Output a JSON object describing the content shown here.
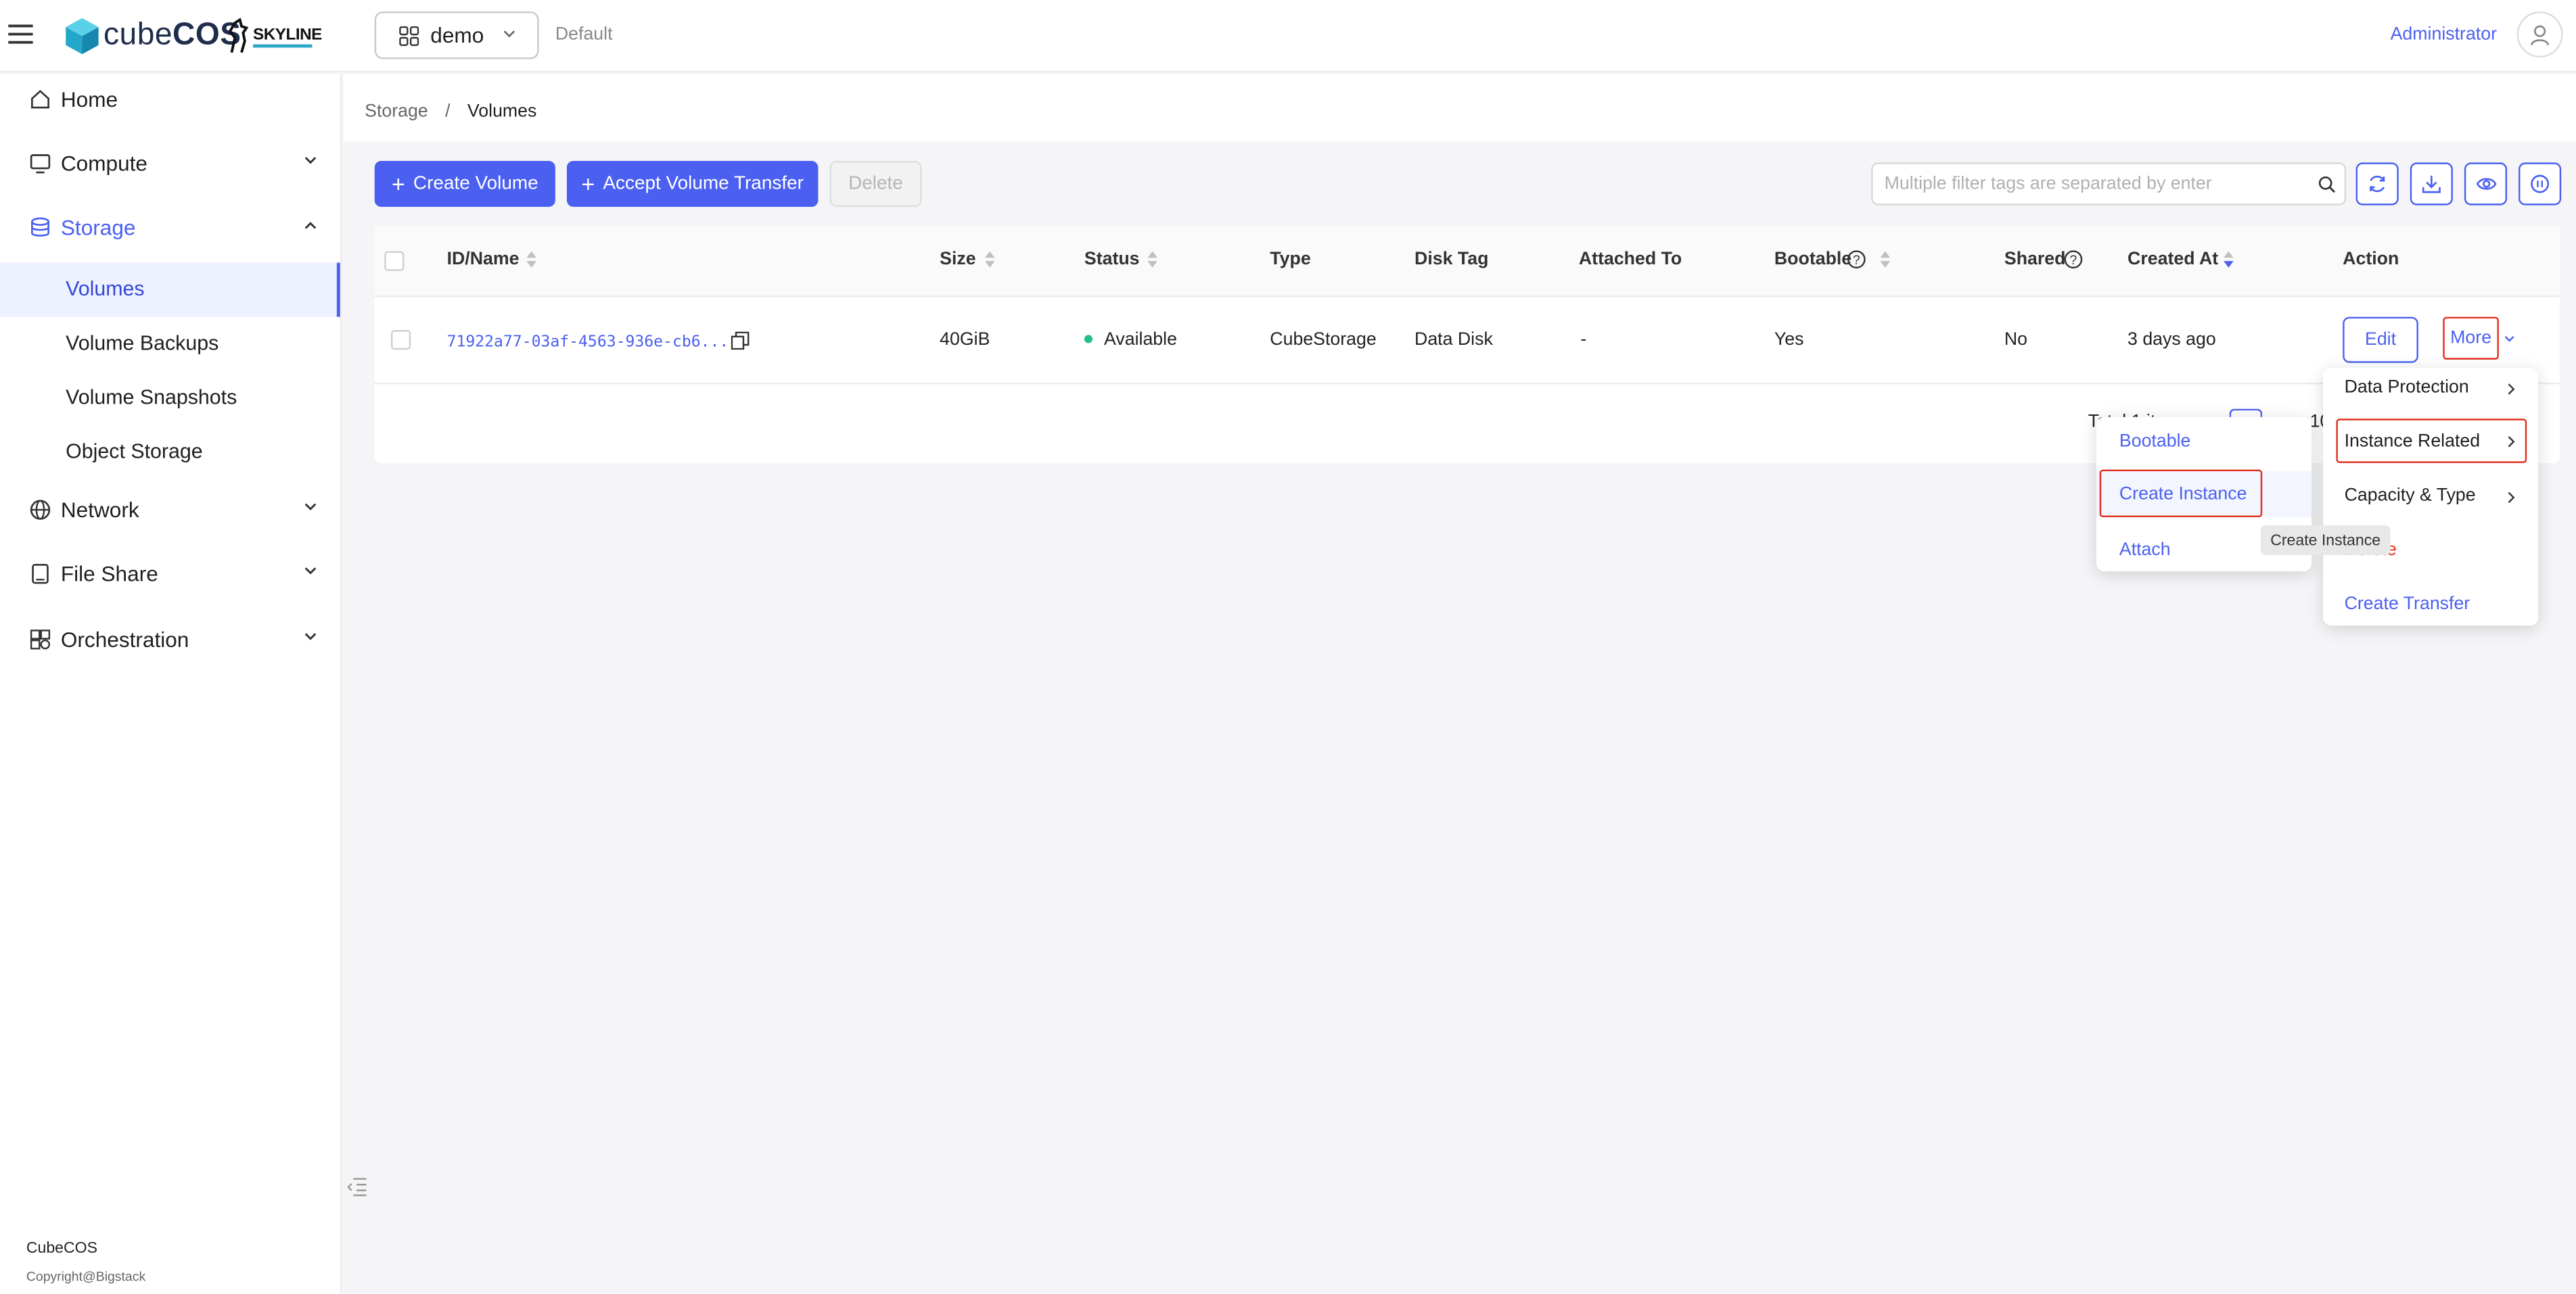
{
  "app": {
    "logo_text_light": "cube",
    "logo_text_bold": "COS",
    "skyline": "SKYLINE",
    "project": "demo",
    "domain": "Default",
    "user": "Administrator"
  },
  "sidebar": {
    "items": [
      {
        "label": "Home",
        "icon": "home-icon"
      },
      {
        "label": "Compute",
        "icon": "monitor-icon"
      },
      {
        "label": "Storage",
        "icon": "database-icon"
      },
      {
        "label": "Network",
        "icon": "globe-icon"
      },
      {
        "label": "File Share",
        "icon": "file-share-icon"
      },
      {
        "label": "Orchestration",
        "icon": "orchestration-icon"
      }
    ],
    "storage_sub": [
      "Volumes",
      "Volume Backups",
      "Volume Snapshots",
      "Object Storage"
    ],
    "footer_name": "CubeCOS",
    "footer_copy": "Copyright@Bigstack"
  },
  "breadcrumb": {
    "parent": "Storage",
    "sep": "/",
    "current": "Volumes"
  },
  "toolbar": {
    "create_volume": "Create Volume",
    "accept_transfer": "Accept Volume Transfer",
    "delete": "Delete",
    "search_placeholder": "Multiple filter tags are separated by enter"
  },
  "table": {
    "columns": [
      "ID/Name",
      "Size",
      "Status",
      "Type",
      "Disk Tag",
      "Attached To",
      "Bootable",
      "Shared",
      "Created At",
      "Action"
    ],
    "rows": [
      {
        "id": "71922a77-03af-4563-936e-cb6...",
        "size": "40GiB",
        "status": "Available",
        "type": "CubeStorage",
        "disk_tag": "Data Disk",
        "attached_to": "-",
        "bootable": "Yes",
        "shared": "No",
        "created_at": "3 days ago",
        "edit": "Edit",
        "more": "More"
      }
    ],
    "pagination_partial": "Total 1 items",
    "page_partial": "10"
  },
  "more_menu": {
    "items": [
      "Data Protection",
      "Instance Related",
      "Capacity & Type",
      "Delete",
      "Create Transfer"
    ]
  },
  "instance_submenu": {
    "items": [
      "Bootable",
      "Create Instance",
      "Attach"
    ]
  },
  "tooltip": "Create Instance",
  "colors": {
    "accent": "#4b60f0",
    "highlight": "#e0301e",
    "status_ok": "#22c08a"
  }
}
